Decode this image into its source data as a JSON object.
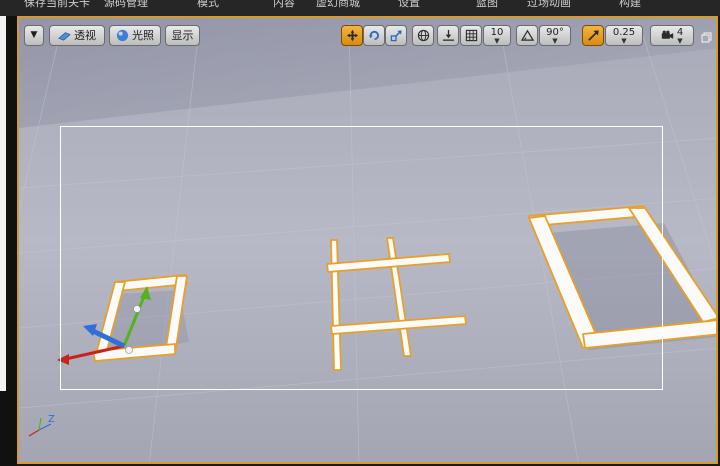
{
  "menubar": {
    "items": [
      "保存当前关卡",
      "源码管理",
      "模式",
      "内容",
      "虚幻商城",
      "设置",
      "蓝图",
      "过场动画",
      "构建"
    ]
  },
  "viewport_toolbar": {
    "perspective_label": "透视",
    "lit_label": "光照",
    "show_label": "显示",
    "grid_snap_value": "10",
    "rotation_snap_value": "90°",
    "scale_snap_value": "0.25",
    "camera_speed_value": "4"
  },
  "axis_indicator": {
    "z_label": "Z"
  },
  "colors": {
    "accent": "#d99a28",
    "floor": "#a6a8b6",
    "frame_fill": "#fbfbfb",
    "frame_outline": "#e8a126",
    "x_axis": "#c8231b",
    "y_axis": "#52b31b",
    "z_axis": "#2f6fd6"
  },
  "icons": [
    "dropdown-arrow-icon",
    "perspective-icon",
    "lit-sphere-icon",
    "translate-icon",
    "rotate-icon",
    "scale-icon",
    "world-local-icon",
    "surface-snap-icon",
    "grid-snap-icon",
    "rotation-snap-icon",
    "scale-snap-icon",
    "camera-speed-icon",
    "maximize-icon"
  ]
}
